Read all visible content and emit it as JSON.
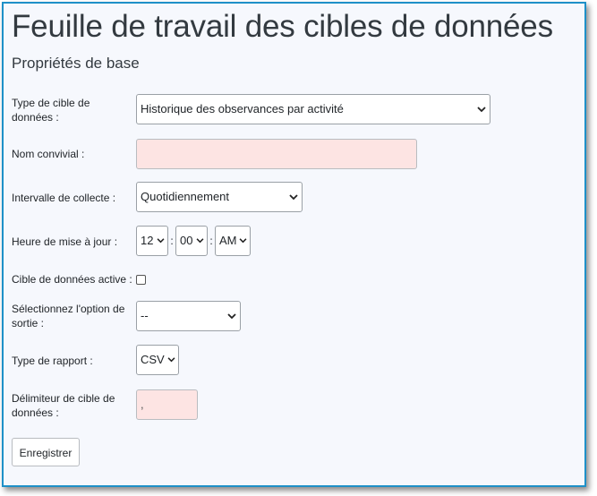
{
  "header": {
    "title": "Feuille de travail des cibles de données",
    "section": "Propriétés de base"
  },
  "form": {
    "target_type": {
      "label": "Type de cible de données :",
      "value": "Historique des observances par activité"
    },
    "friendly_name": {
      "label": "Nom convivial :",
      "value": ""
    },
    "interval": {
      "label": "Intervalle de collecte :",
      "value": "Quotidiennement"
    },
    "update_time": {
      "label": "Heure de mise à jour :",
      "hour": "12",
      "minute": "00",
      "ampm": "AM",
      "separator": ":"
    },
    "active": {
      "label": "Cible de données active :",
      "checked": false
    },
    "output_option": {
      "label": "Sélectionnez l'option de sortie :",
      "value": "--"
    },
    "report_type": {
      "label": "Type de rapport :",
      "value": "CSV"
    },
    "delimiter": {
      "label": "Délimiteur de cible de données :",
      "value": ","
    }
  },
  "actions": {
    "save_label": "Enregistrer"
  },
  "colors": {
    "border_accent": "#1e90c8",
    "required_field_bg": "#fde4e3",
    "panel_bg": "#f6f8fd"
  },
  "icons": {
    "dropdown": "chevron-down-icon"
  }
}
